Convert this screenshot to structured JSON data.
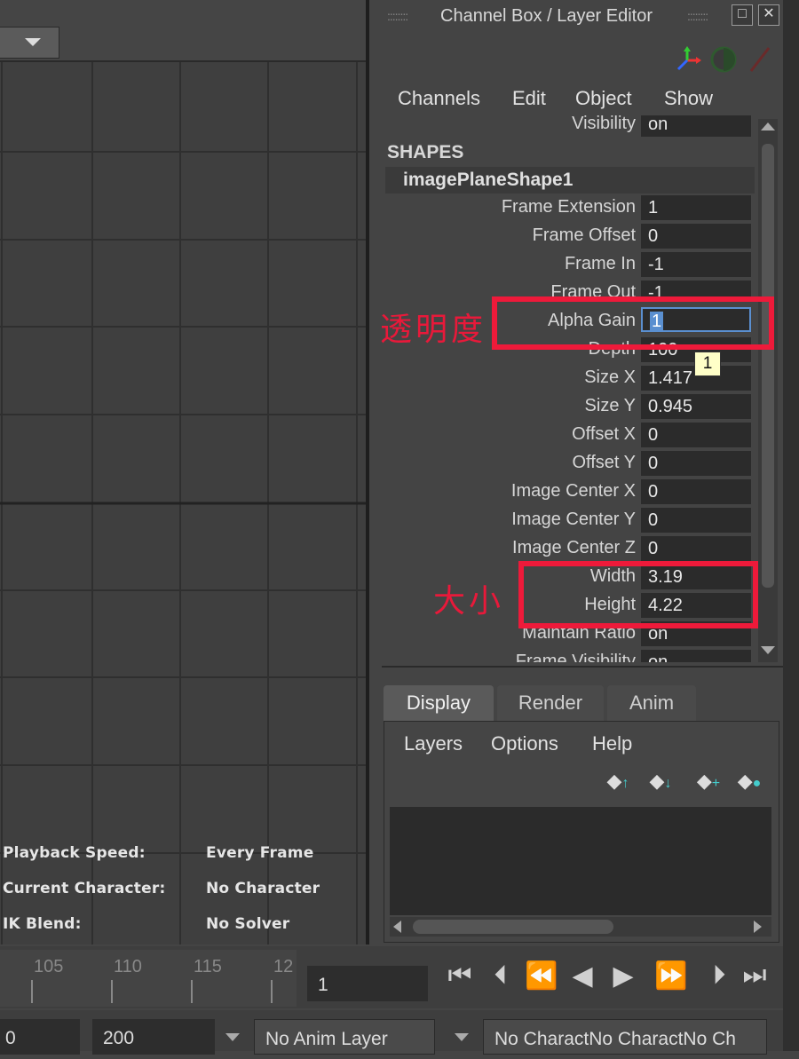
{
  "panel": {
    "title": "Channel Box / Layer Editor",
    "restore_icon": "□",
    "close_icon": "✕",
    "menus": [
      "Channels",
      "Edit",
      "Object",
      "Show"
    ],
    "visibility_label": "Visibility",
    "visibility_value": "on",
    "section_header": "SHAPES",
    "shape_name": "imagePlaneShape1",
    "attributes": [
      {
        "label": "Frame Extension",
        "value": "1"
      },
      {
        "label": "Frame Offset",
        "value": "0"
      },
      {
        "label": "Frame In",
        "value": "-1"
      },
      {
        "label": "Frame Out",
        "value": "-1"
      },
      {
        "label": "Alpha Gain",
        "value": "1"
      },
      {
        "label": "Depth",
        "value": "100"
      },
      {
        "label": "Size X",
        "value": "1.417"
      },
      {
        "label": "Size Y",
        "value": "0.945"
      },
      {
        "label": "Offset X",
        "value": "0"
      },
      {
        "label": "Offset Y",
        "value": "0"
      },
      {
        "label": "Image Center X",
        "value": "0"
      },
      {
        "label": "Image Center Y",
        "value": "0"
      },
      {
        "label": "Image Center Z",
        "value": "0"
      },
      {
        "label": "Width",
        "value": "3.19"
      },
      {
        "label": "Height",
        "value": "4.22"
      },
      {
        "label": "Maintain Ratio",
        "value": "on"
      },
      {
        "label": "Frame Visibility",
        "value": "on"
      }
    ],
    "tooltip": "1",
    "annotation_alpha": "透明度",
    "annotation_size": "大小",
    "colors": {
      "highlight": "#ee1a3a",
      "field_bg": "#2b2b2b"
    }
  },
  "layer_editor": {
    "tabs": [
      "Display",
      "Render",
      "Anim"
    ],
    "active_tab": "Display",
    "menus": [
      "Layers",
      "Options",
      "Help"
    ]
  },
  "viewport": {
    "hud": [
      {
        "label": "Playback Speed:",
        "value": "Every Frame"
      },
      {
        "label": "Current Character:",
        "value": "No Character"
      },
      {
        "label": "IK Blend:",
        "value": "No Solver"
      }
    ]
  },
  "timeline": {
    "ticks": [
      "105",
      "110",
      "115",
      "12"
    ],
    "current_frame": "1"
  },
  "range_bar": {
    "start_value": "0",
    "end_value": "200",
    "anim_layer": "No Anim Layer",
    "character": "No CharactNo CharactNo Ch"
  }
}
